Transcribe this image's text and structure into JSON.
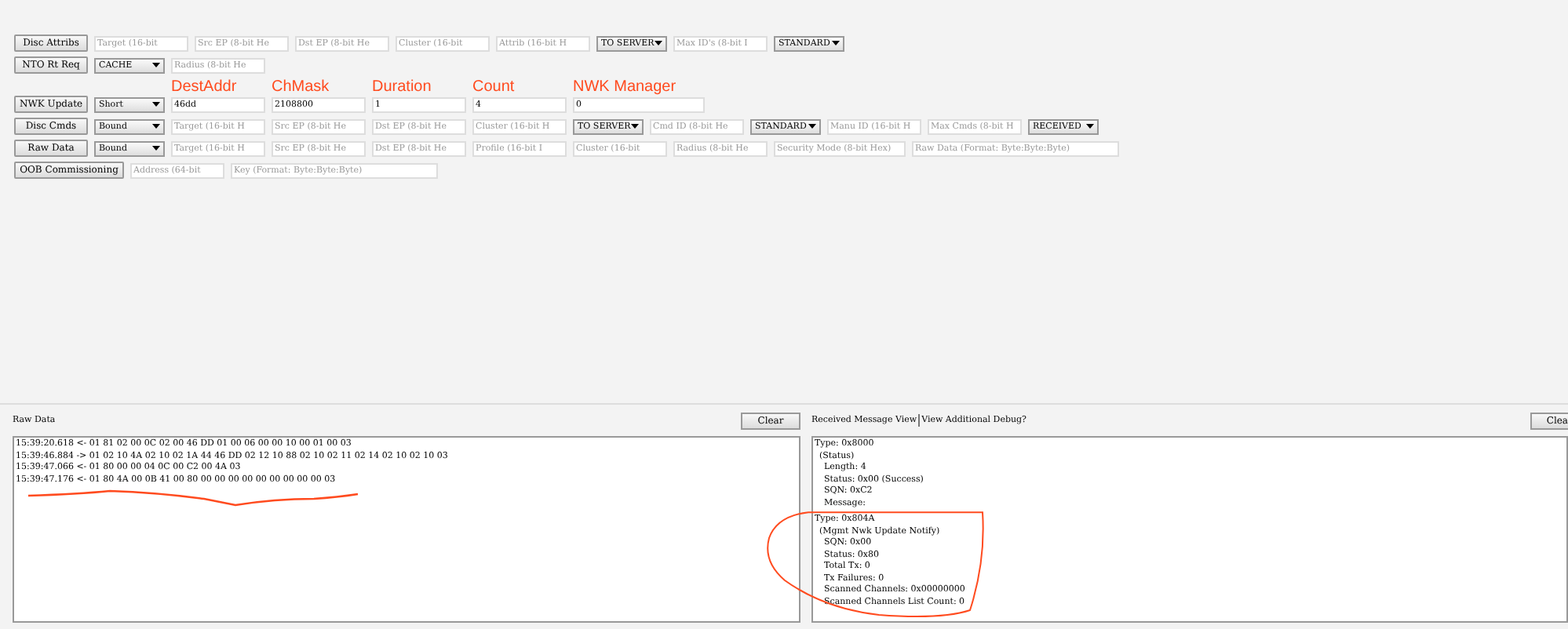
{
  "command_rows": [
    {
      "button": "Disc Attribs",
      "fields": [
        {
          "kind": "input",
          "placeholder": "Target (16-bit"
        },
        {
          "kind": "input",
          "placeholder": "Src EP (8-bit He"
        },
        {
          "kind": "input",
          "placeholder": "Dst EP (8-bit He"
        },
        {
          "kind": "input",
          "placeholder": "Cluster (16-bit"
        },
        {
          "kind": "input",
          "placeholder": "Attrib (16-bit H"
        },
        {
          "kind": "select",
          "value": "TO SERVER"
        },
        {
          "kind": "input",
          "placeholder": "Max ID's (8-bit I"
        },
        {
          "kind": "select",
          "value": "STANDARD"
        }
      ]
    },
    {
      "button": "NTO Rt Req",
      "fields": [
        {
          "kind": "select",
          "value": "CACHE"
        },
        {
          "kind": "input",
          "placeholder": "Radius (8-bit He"
        }
      ]
    },
    {
      "button": "NWK Update",
      "fields": [
        {
          "kind": "select",
          "value": "Short"
        },
        {
          "kind": "input",
          "value": "46dd",
          "annotation": "DestAddr"
        },
        {
          "kind": "input",
          "value": "2108800",
          "annotation": "ChMask"
        },
        {
          "kind": "input",
          "value": "1",
          "annotation": "Duration"
        },
        {
          "kind": "input",
          "value": "4",
          "annotation": "Count"
        },
        {
          "kind": "long",
          "value": "0",
          "annotation": "NWK Manager"
        }
      ]
    },
    {
      "button": "Disc Cmds",
      "fields": [
        {
          "kind": "select",
          "value": "Bound"
        },
        {
          "kind": "input",
          "placeholder": "Target (16-bit H"
        },
        {
          "kind": "input",
          "placeholder": "Src EP (8-bit He"
        },
        {
          "kind": "input",
          "placeholder": "Dst EP (8-bit He"
        },
        {
          "kind": "input",
          "placeholder": "Cluster (16-bit H"
        },
        {
          "kind": "select",
          "value": "TO SERVER"
        },
        {
          "kind": "input",
          "placeholder": "Cmd ID (8-bit He"
        },
        {
          "kind": "select",
          "value": "STANDARD"
        },
        {
          "kind": "input",
          "placeholder": "Manu ID (16-bit H"
        },
        {
          "kind": "input",
          "placeholder": "Max Cmds (8-bit H"
        },
        {
          "kind": "select",
          "value": "RECEIVED"
        }
      ]
    },
    {
      "button": "Raw Data",
      "fields": [
        {
          "kind": "select",
          "value": "Bound"
        },
        {
          "kind": "input",
          "placeholder": "Target (16-bit H"
        },
        {
          "kind": "input",
          "placeholder": "Src EP (8-bit He"
        },
        {
          "kind": "input",
          "placeholder": "Dst EP (8-bit He"
        },
        {
          "kind": "input",
          "placeholder": "Profile (16-bit I"
        },
        {
          "kind": "input",
          "placeholder": "Cluster (16-bit"
        },
        {
          "kind": "input",
          "placeholder": "Radius (8-bit He"
        },
        {
          "kind": "long",
          "placeholder": "Security Mode (8-bit Hex)"
        },
        {
          "kind": "wide",
          "placeholder": "Raw Data (Format: Byte:Byte:Byte)"
        }
      ]
    },
    {
      "button": "OOB Commissioning",
      "fields": [
        {
          "kind": "input",
          "placeholder": "Address (64-bit"
        },
        {
          "kind": "wide",
          "placeholder": "Key (Format: Byte:Byte:Byte)"
        }
      ]
    }
  ],
  "raw_data": {
    "label": "Raw Data",
    "clear": "Clear",
    "lines": [
      "15:39:20.618 <- 01 81 02 00 0C 02 00 46 DD 01 00 06 00 00 10 00 01 00 03",
      "15:39:46.884 -> 01 02 10 4A 02 10 02 1A 44 46 DD 02 12 10 88 02 10 02 11 02 14 02 10 02 10 03",
      "15:39:47.066 <- 01 80 00 00 04 0C 00 C2 00 4A 03",
      "15:39:47.176 <- 01 80 4A 00 0B 41 00 80 00 00 00 00 00 00 00 00 00 03"
    ]
  },
  "received": {
    "label": "Received Message View",
    "debug_label": "View Additional Debug?",
    "clear": "Clea",
    "messages": [
      {
        "type": "Type: 0x8000",
        "name": "(Status)",
        "children": [
          "Length: 4",
          "Status: 0x00 (Success)",
          "SQN: 0xC2",
          "Message:"
        ]
      },
      {
        "type": "Type: 0x804A",
        "name": "(Mgmt Nwk Update Notify)",
        "children": [
          "SQN: 0x00",
          "Status: 0x80",
          "Total Tx: 0",
          "Tx Failures: 0",
          "Scanned Channels: 0x00000000",
          "Scanned Channels List Count: 0"
        ]
      }
    ]
  }
}
